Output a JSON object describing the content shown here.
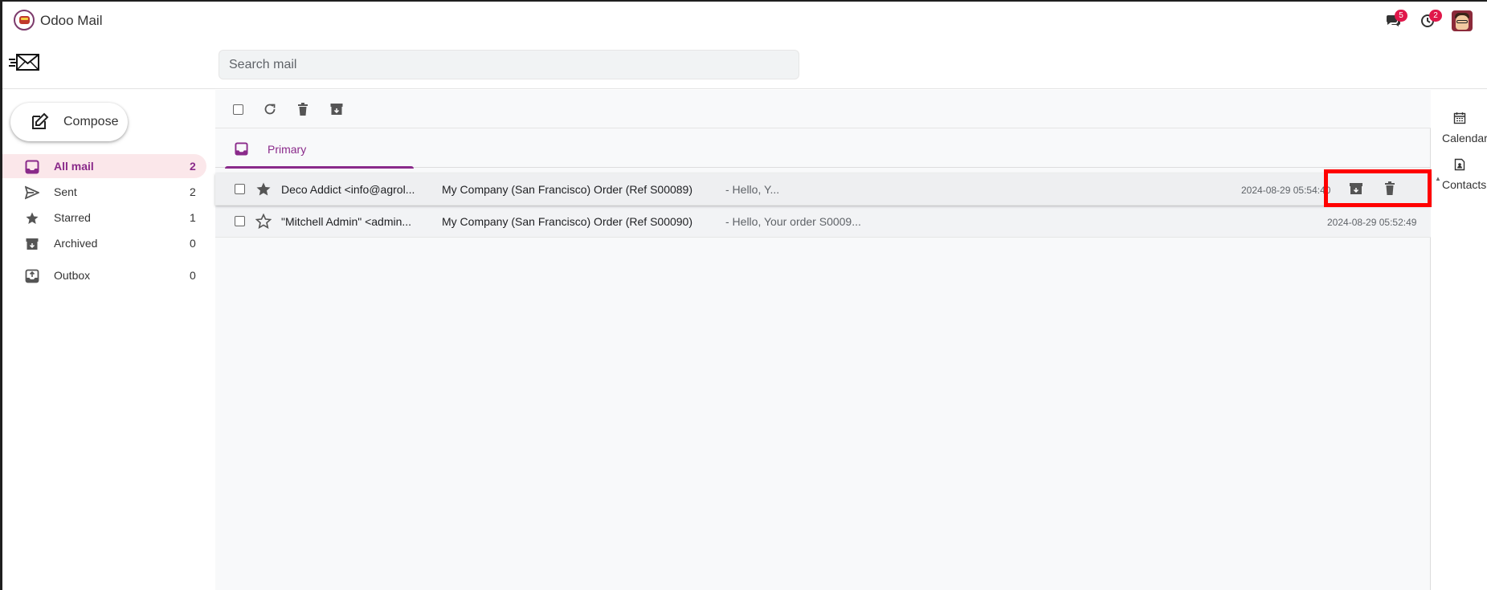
{
  "app": {
    "title": "Odoo Mail"
  },
  "navbar": {
    "messages_badge": "5",
    "activities_badge": "2"
  },
  "search": {
    "placeholder": "Search mail"
  },
  "sidebar": {
    "compose_label": "Compose",
    "items": [
      {
        "label": "All mail",
        "count": "2",
        "icon": "inbox-icon",
        "active": true
      },
      {
        "label": "Sent",
        "count": "2",
        "icon": "send-icon"
      },
      {
        "label": "Starred",
        "count": "1",
        "icon": "star-icon"
      },
      {
        "label": "Archived",
        "count": "0",
        "icon": "archive-icon"
      },
      {
        "label": "Outbox",
        "count": "0",
        "icon": "outbox-icon"
      }
    ]
  },
  "tabs": {
    "primary": "Primary"
  },
  "mails": [
    {
      "sender": "Deco Addict <info@agrol...",
      "subject": "My Company (San Francisco) Order (Ref S00089)",
      "snippet": "-  Hello, Y...",
      "date": "2024-08-29 05:54:40",
      "starred": true
    },
    {
      "sender": "\"Mitchell Admin\" <admin...",
      "subject": "My Company (San Francisco) Order (Ref S00090)",
      "snippet": "-   Hello, Your order S0009...",
      "date": "2024-08-29 05:52:49",
      "starred": false
    }
  ],
  "right_apps": [
    {
      "label": "Calendar",
      "icon": "calendar-icon"
    },
    {
      "label": "Contacts",
      "icon": "contacts-icon"
    }
  ],
  "colors": {
    "accent": "#8a2a8a",
    "active_bg": "#fbe7ea",
    "badge": "#e0174a",
    "highlight": "#ff0000"
  }
}
